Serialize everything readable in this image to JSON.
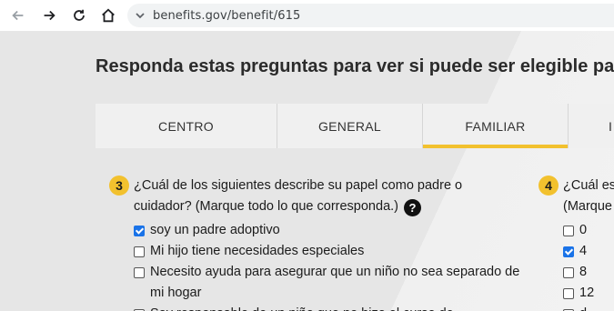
{
  "browser": {
    "url": "benefits.gov/benefit/615"
  },
  "page": {
    "title": "Responda estas preguntas para ver si puede ser elegible pa"
  },
  "tabs": [
    {
      "label": "CENTRO",
      "active": false
    },
    {
      "label": "GENERAL",
      "active": false
    },
    {
      "label": "FAMILIAR",
      "active": true
    },
    {
      "label": "I",
      "active": false
    }
  ],
  "question3": {
    "number": "3",
    "line1": "¿Cuál de los siguientes describe su papel como padre o",
    "line2": "cuidador? (Marque todo lo que corresponda.)",
    "help_glyph": "?",
    "options": [
      {
        "label": "soy un padre adoptivo",
        "checked": true
      },
      {
        "label": "Mi hijo tiene necesidades especiales",
        "checked": false
      },
      {
        "label": "Necesito ayuda para asegurar que un niño no sea separado de",
        "checked": false
      },
      {
        "label": "mi hogar",
        "checked": false
      },
      {
        "label": "Soy responsable de un niño que no hizo el curso de...",
        "checked": false
      }
    ]
  },
  "question4": {
    "number": "4",
    "line1": "¿Cuál es",
    "line2": "(Marque",
    "options": [
      {
        "label": "0",
        "checked": false
      },
      {
        "label": "4",
        "checked": true
      },
      {
        "label": "8",
        "checked": false
      },
      {
        "label": "12",
        "checked": false
      },
      {
        "label": "d",
        "checked": false
      }
    ]
  },
  "colors": {
    "accent": "#f2c12e",
    "checkbox_checked": "#1a73e8"
  }
}
